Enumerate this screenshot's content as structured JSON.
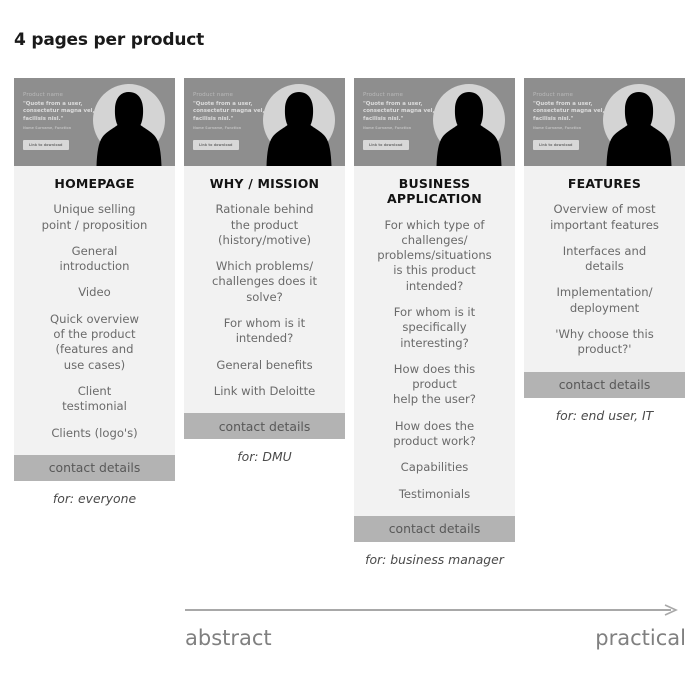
{
  "page": {
    "title": "4 pages per product",
    "background_color": "#ffffff"
  },
  "mock_page": {
    "product_name": "Product name",
    "quote": "\"Quote from a user, consectetur magna vel, facilisis nisl.\"",
    "attribution": "Name Surname, Function",
    "download_button": "Link to download",
    "avatar_icon": "person-silhouette-icon",
    "hero_bg_color": "#8e8e8e",
    "avatar_circle_color": "#d4d4d4",
    "silhouette_color": "#000000"
  },
  "colors": {
    "card_body": "#f2f2f2",
    "contact_bar": "#b3b3b3",
    "heading_text": "#131313",
    "item_text": "#6a6a6a",
    "axis": "#a8a8a8"
  },
  "columns": [
    {
      "heading": "HOMEPAGE",
      "items": [
        "Unique selling\npoint / proposition",
        "General\nintroduction",
        "Video",
        "Quick overview\nof the product\n(features and\nuse cases)",
        "Client\ntestimonial",
        "Clients (logo's)"
      ],
      "contact": "contact details",
      "audience": "for: everyone"
    },
    {
      "heading": "WHY / MISSION",
      "items": [
        "Rationale behind\nthe product\n(history/motive)",
        "Which problems/\nchallenges does it\nsolve?",
        "For whom is it\nintended?",
        "General benefits",
        "Link with Deloitte"
      ],
      "contact": "contact details",
      "audience": "for: DMU"
    },
    {
      "heading": "BUSINESS\nAPPLICATION",
      "items": [
        "For which type of\nchallenges/\nproblems/situations\nis this product\nintended?",
        "For whom is it\nspecifically\ninteresting?",
        "How does this\nproduct\nhelp the user?",
        "How does the\nproduct work?",
        "Capabilities",
        "Testimonials"
      ],
      "contact": "contact details",
      "audience": "for: business manager"
    },
    {
      "heading": "FEATURES",
      "items": [
        "Overview of most\nimportant features",
        "Interfaces and\ndetails",
        "Implementation/\ndeployment",
        "'Why choose this\nproduct?'"
      ],
      "contact": "contact details",
      "audience": "for: end user, IT"
    }
  ],
  "axis": {
    "left_label": "abstract",
    "right_label": "practical",
    "arrow_direction": "right"
  }
}
